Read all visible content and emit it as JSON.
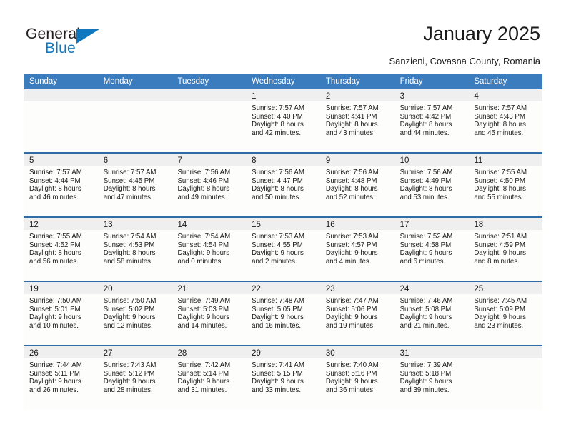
{
  "brand": {
    "name_part1": "General",
    "name_part2": "Blue",
    "accent_color": "#1278BE",
    "logo_icon": "triangle-logo-icon"
  },
  "header": {
    "title": "January 2025",
    "subtitle": "Sanzieni, Covasna County, Romania"
  },
  "calendar": {
    "header_color": "#3B7CBF",
    "row_border_color": "#2E6CA8",
    "daynum_band_color": "#EFEFEF",
    "weekdays": [
      "Sunday",
      "Monday",
      "Tuesday",
      "Wednesday",
      "Thursday",
      "Friday",
      "Saturday"
    ],
    "weeks": [
      [
        {
          "day": "",
          "empty": true
        },
        {
          "day": "",
          "empty": true
        },
        {
          "day": "",
          "empty": true
        },
        {
          "day": "1",
          "sunrise": "Sunrise: 7:57 AM",
          "sunset": "Sunset: 4:40 PM",
          "daylight1": "Daylight: 8 hours",
          "daylight2": "and 42 minutes."
        },
        {
          "day": "2",
          "sunrise": "Sunrise: 7:57 AM",
          "sunset": "Sunset: 4:41 PM",
          "daylight1": "Daylight: 8 hours",
          "daylight2": "and 43 minutes."
        },
        {
          "day": "3",
          "sunrise": "Sunrise: 7:57 AM",
          "sunset": "Sunset: 4:42 PM",
          "daylight1": "Daylight: 8 hours",
          "daylight2": "and 44 minutes."
        },
        {
          "day": "4",
          "sunrise": "Sunrise: 7:57 AM",
          "sunset": "Sunset: 4:43 PM",
          "daylight1": "Daylight: 8 hours",
          "daylight2": "and 45 minutes."
        }
      ],
      [
        {
          "day": "5",
          "sunrise": "Sunrise: 7:57 AM",
          "sunset": "Sunset: 4:44 PM",
          "daylight1": "Daylight: 8 hours",
          "daylight2": "and 46 minutes."
        },
        {
          "day": "6",
          "sunrise": "Sunrise: 7:57 AM",
          "sunset": "Sunset: 4:45 PM",
          "daylight1": "Daylight: 8 hours",
          "daylight2": "and 47 minutes."
        },
        {
          "day": "7",
          "sunrise": "Sunrise: 7:56 AM",
          "sunset": "Sunset: 4:46 PM",
          "daylight1": "Daylight: 8 hours",
          "daylight2": "and 49 minutes."
        },
        {
          "day": "8",
          "sunrise": "Sunrise: 7:56 AM",
          "sunset": "Sunset: 4:47 PM",
          "daylight1": "Daylight: 8 hours",
          "daylight2": "and 50 minutes."
        },
        {
          "day": "9",
          "sunrise": "Sunrise: 7:56 AM",
          "sunset": "Sunset: 4:48 PM",
          "daylight1": "Daylight: 8 hours",
          "daylight2": "and 52 minutes."
        },
        {
          "day": "10",
          "sunrise": "Sunrise: 7:56 AM",
          "sunset": "Sunset: 4:49 PM",
          "daylight1": "Daylight: 8 hours",
          "daylight2": "and 53 minutes."
        },
        {
          "day": "11",
          "sunrise": "Sunrise: 7:55 AM",
          "sunset": "Sunset: 4:50 PM",
          "daylight1": "Daylight: 8 hours",
          "daylight2": "and 55 minutes."
        }
      ],
      [
        {
          "day": "12",
          "sunrise": "Sunrise: 7:55 AM",
          "sunset": "Sunset: 4:52 PM",
          "daylight1": "Daylight: 8 hours",
          "daylight2": "and 56 minutes."
        },
        {
          "day": "13",
          "sunrise": "Sunrise: 7:54 AM",
          "sunset": "Sunset: 4:53 PM",
          "daylight1": "Daylight: 8 hours",
          "daylight2": "and 58 minutes."
        },
        {
          "day": "14",
          "sunrise": "Sunrise: 7:54 AM",
          "sunset": "Sunset: 4:54 PM",
          "daylight1": "Daylight: 9 hours",
          "daylight2": "and 0 minutes."
        },
        {
          "day": "15",
          "sunrise": "Sunrise: 7:53 AM",
          "sunset": "Sunset: 4:55 PM",
          "daylight1": "Daylight: 9 hours",
          "daylight2": "and 2 minutes."
        },
        {
          "day": "16",
          "sunrise": "Sunrise: 7:53 AM",
          "sunset": "Sunset: 4:57 PM",
          "daylight1": "Daylight: 9 hours",
          "daylight2": "and 4 minutes."
        },
        {
          "day": "17",
          "sunrise": "Sunrise: 7:52 AM",
          "sunset": "Sunset: 4:58 PM",
          "daylight1": "Daylight: 9 hours",
          "daylight2": "and 6 minutes."
        },
        {
          "day": "18",
          "sunrise": "Sunrise: 7:51 AM",
          "sunset": "Sunset: 4:59 PM",
          "daylight1": "Daylight: 9 hours",
          "daylight2": "and 8 minutes."
        }
      ],
      [
        {
          "day": "19",
          "sunrise": "Sunrise: 7:50 AM",
          "sunset": "Sunset: 5:01 PM",
          "daylight1": "Daylight: 9 hours",
          "daylight2": "and 10 minutes."
        },
        {
          "day": "20",
          "sunrise": "Sunrise: 7:50 AM",
          "sunset": "Sunset: 5:02 PM",
          "daylight1": "Daylight: 9 hours",
          "daylight2": "and 12 minutes."
        },
        {
          "day": "21",
          "sunrise": "Sunrise: 7:49 AM",
          "sunset": "Sunset: 5:03 PM",
          "daylight1": "Daylight: 9 hours",
          "daylight2": "and 14 minutes."
        },
        {
          "day": "22",
          "sunrise": "Sunrise: 7:48 AM",
          "sunset": "Sunset: 5:05 PM",
          "daylight1": "Daylight: 9 hours",
          "daylight2": "and 16 minutes."
        },
        {
          "day": "23",
          "sunrise": "Sunrise: 7:47 AM",
          "sunset": "Sunset: 5:06 PM",
          "daylight1": "Daylight: 9 hours",
          "daylight2": "and 19 minutes."
        },
        {
          "day": "24",
          "sunrise": "Sunrise: 7:46 AM",
          "sunset": "Sunset: 5:08 PM",
          "daylight1": "Daylight: 9 hours",
          "daylight2": "and 21 minutes."
        },
        {
          "day": "25",
          "sunrise": "Sunrise: 7:45 AM",
          "sunset": "Sunset: 5:09 PM",
          "daylight1": "Daylight: 9 hours",
          "daylight2": "and 23 minutes."
        }
      ],
      [
        {
          "day": "26",
          "sunrise": "Sunrise: 7:44 AM",
          "sunset": "Sunset: 5:11 PM",
          "daylight1": "Daylight: 9 hours",
          "daylight2": "and 26 minutes."
        },
        {
          "day": "27",
          "sunrise": "Sunrise: 7:43 AM",
          "sunset": "Sunset: 5:12 PM",
          "daylight1": "Daylight: 9 hours",
          "daylight2": "and 28 minutes."
        },
        {
          "day": "28",
          "sunrise": "Sunrise: 7:42 AM",
          "sunset": "Sunset: 5:14 PM",
          "daylight1": "Daylight: 9 hours",
          "daylight2": "and 31 minutes."
        },
        {
          "day": "29",
          "sunrise": "Sunrise: 7:41 AM",
          "sunset": "Sunset: 5:15 PM",
          "daylight1": "Daylight: 9 hours",
          "daylight2": "and 33 minutes."
        },
        {
          "day": "30",
          "sunrise": "Sunrise: 7:40 AM",
          "sunset": "Sunset: 5:16 PM",
          "daylight1": "Daylight: 9 hours",
          "daylight2": "and 36 minutes."
        },
        {
          "day": "31",
          "sunrise": "Sunrise: 7:39 AM",
          "sunset": "Sunset: 5:18 PM",
          "daylight1": "Daylight: 9 hours",
          "daylight2": "and 39 minutes."
        },
        {
          "day": "",
          "empty": true
        }
      ]
    ]
  }
}
